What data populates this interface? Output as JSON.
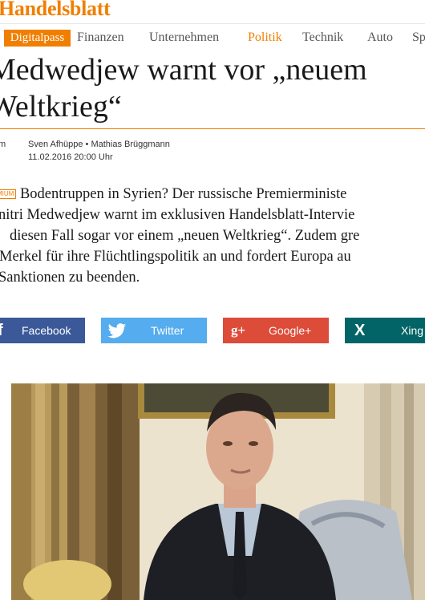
{
  "site": {
    "logo": "Handelsblatt"
  },
  "nav": {
    "digitalpass": "Digitalpass",
    "items": [
      "Finanzen",
      "Unternehmen",
      "Politik",
      "Technik",
      "Auto",
      "Sp"
    ],
    "active": "Politik"
  },
  "article": {
    "headline_line1": "Medwedjew warnt vor „neuem",
    "headline_line2": "Weltkrieg“",
    "authors": "Sven Afhüppe • Mathias Brüggmann",
    "date": "11.02.2016 20:00 Uhr",
    "edge_text_1": "m",
    "edge_text_2": "",
    "premium_badge": "MIUM",
    "lead_lines": [
      "Bodentruppen in Syrien? Der russische Premierministe",
      "nitri Medwedjew warnt im exklusiven Handelsblatt-Intervie",
      "diesen Fall sogar vor einem „neuen Weltkrieg“. Zudem gre",
      "Merkel für ihre Flüchtlingspolitik an und fordert Europa au",
      "Sanktionen zu beenden."
    ]
  },
  "share": {
    "facebook": "Facebook",
    "twitter": "Twitter",
    "googleplus": "Google+",
    "xing": "Xing",
    "colors": {
      "facebook": "#3b5998",
      "twitter": "#55acee",
      "googleplus": "#dd4b39",
      "xing": "#026466"
    }
  },
  "colors": {
    "accent": "#f07f00"
  },
  "icons": {
    "facebook": "facebook-icon",
    "twitter": "twitter-icon",
    "googleplus": "googleplus-icon",
    "xing": "xing-icon"
  }
}
